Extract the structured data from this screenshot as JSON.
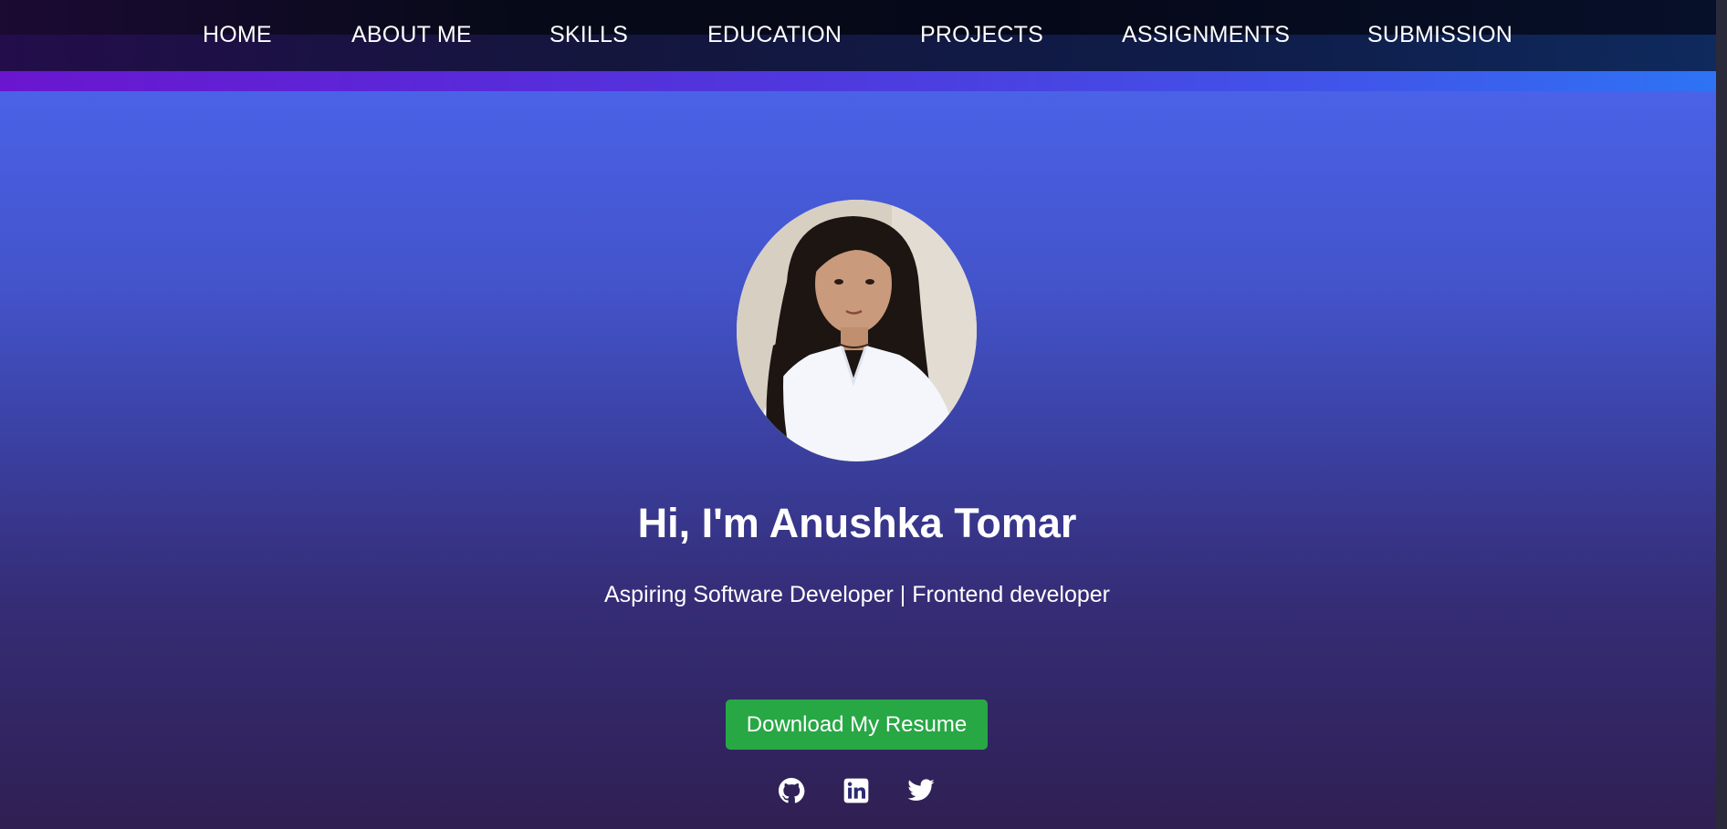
{
  "nav": {
    "items": [
      {
        "label": "HOME"
      },
      {
        "label": "ABOUT ME"
      },
      {
        "label": "SKILLS"
      },
      {
        "label": "EDUCATION"
      },
      {
        "label": "PROJECTS"
      },
      {
        "label": "ASSIGNMENTS"
      },
      {
        "label": "SUBMISSION"
      }
    ]
  },
  "hero": {
    "heading": "Hi, I'm Anushka Tomar",
    "subtitle": "Aspiring Software Developer | Frontend developer",
    "resume_button": "Download My Resume",
    "social": [
      {
        "icon": "github-icon"
      },
      {
        "icon": "linkedin-icon"
      },
      {
        "icon": "twitter-icon"
      }
    ]
  },
  "colors": {
    "accent_green": "#28a745",
    "text": "#ffffff",
    "nav_bg": "#05081a",
    "gradient_top": "#4f6ff2",
    "gradient_bottom": "#2f1f52"
  }
}
